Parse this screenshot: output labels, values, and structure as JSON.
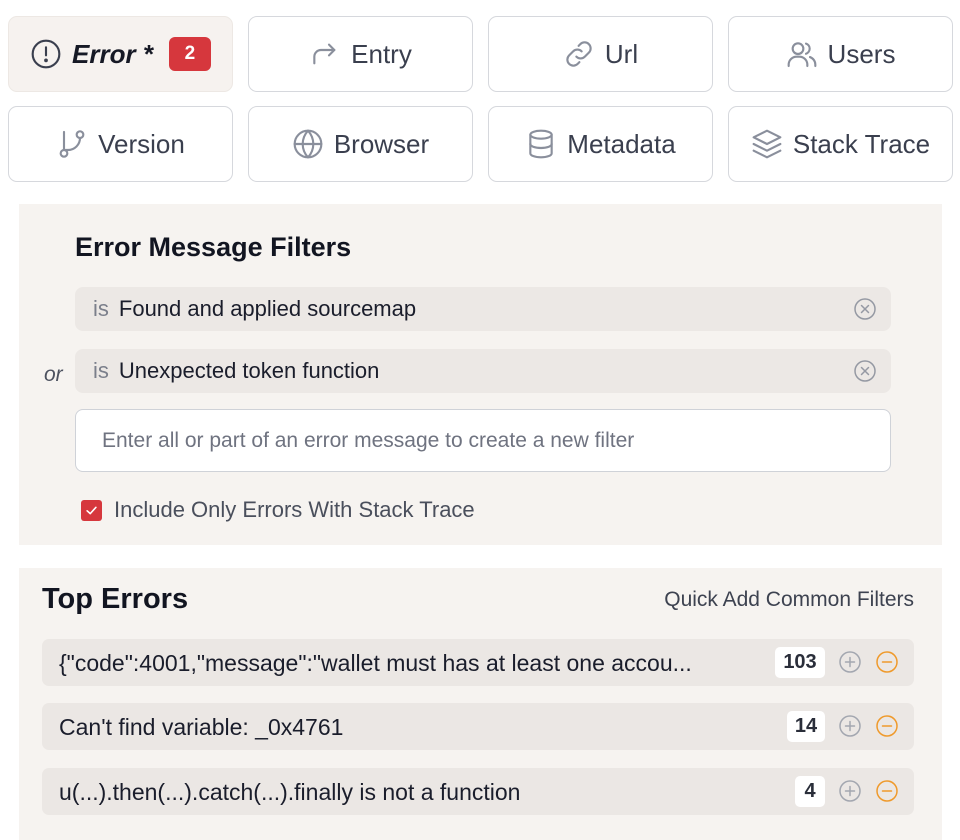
{
  "tabs": [
    {
      "label": "Error *",
      "icon": "exclamation-circle-icon",
      "badge": "2",
      "active": true
    },
    {
      "label": "Entry",
      "icon": "share-arrow-icon"
    },
    {
      "label": "Url",
      "icon": "link-icon"
    },
    {
      "label": "Users",
      "icon": "users-icon"
    },
    {
      "label": "Version",
      "icon": "git-branch-icon"
    },
    {
      "label": "Browser",
      "icon": "globe-icon"
    },
    {
      "label": "Metadata",
      "icon": "database-icon"
    },
    {
      "label": "Stack Trace",
      "icon": "layers-icon"
    }
  ],
  "filters": {
    "title": "Error Message Filters",
    "items": [
      {
        "operator": "is",
        "value": "Found and applied sourcemap"
      },
      {
        "operator": "is",
        "value": "Unexpected token function"
      }
    ],
    "or_label": "or",
    "input_placeholder": "Enter all or part of an error message to create a new filter",
    "checkbox_label": "Include Only Errors With Stack Trace",
    "checkbox_checked": true
  },
  "top_errors": {
    "title": "Top Errors",
    "quick_add_label": "Quick Add Common Filters",
    "rows": [
      {
        "message": "{\"code\":4001,\"message\":\"wallet must has at least one accou...",
        "count": "103"
      },
      {
        "message": "Can't find variable: _0x4761",
        "count": "14"
      },
      {
        "message": "u(...).then(...).catch(...).finally is not a function",
        "count": "4"
      }
    ]
  },
  "colors": {
    "accent_red": "#d6373d",
    "exclude_orange": "#ef9a2c",
    "panel_bg": "#f6f3f0"
  }
}
